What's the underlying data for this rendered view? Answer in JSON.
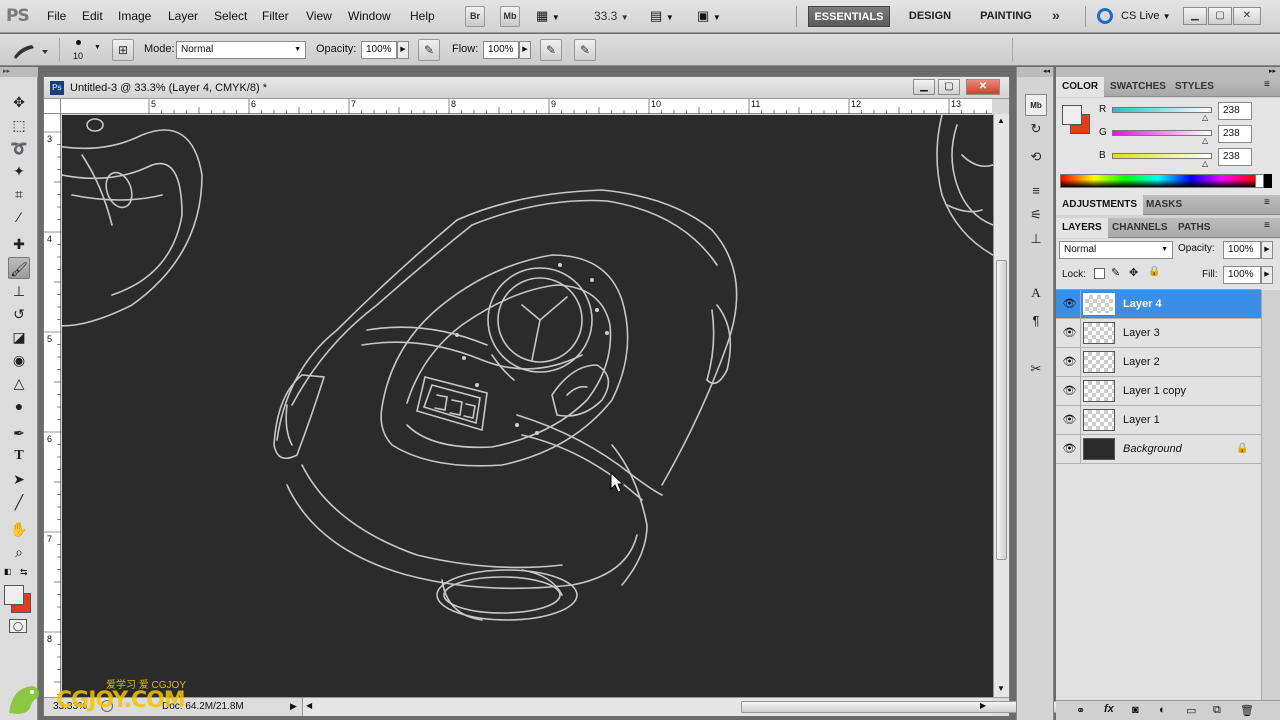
{
  "app": {
    "logo": "PS"
  },
  "menu": [
    "File",
    "Edit",
    "Image",
    "Layer",
    "Select",
    "Filter",
    "View",
    "Window",
    "Help"
  ],
  "menubar": {
    "br_label": "Br",
    "mb_label": "Mb",
    "zoom": "33.3",
    "workspaces": [
      "ESSENTIALS",
      "DESIGN",
      "PAINTING"
    ],
    "active_workspace": "ESSENTIALS",
    "cs_live": "CS Live"
  },
  "options": {
    "brush_size": "10",
    "mode_label": "Mode:",
    "mode_value": "Normal",
    "opacity_label": "Opacity:",
    "opacity_value": "100%",
    "flow_label": "Flow:",
    "flow_value": "100%"
  },
  "document": {
    "title": "Untitled-3 @ 33.3% (Layer 4, CMYK/8) *",
    "ps_badge": "Ps",
    "ruler_top": [
      "5",
      "6",
      "7",
      "8",
      "9",
      "10",
      "11",
      "12",
      "13"
    ],
    "ruler_left": [
      "3",
      "4",
      "5",
      "6",
      "7",
      "8"
    ],
    "status_zoom": "33.33%",
    "status_doc": "Doc: 64.2M/21.8M"
  },
  "color_panel": {
    "tabs": [
      "COLOR",
      "SWATCHES",
      "STYLES"
    ],
    "channels": [
      {
        "label": "R",
        "value": "238",
        "color": "#25c8d8"
      },
      {
        "label": "G",
        "value": "238",
        "color": "#d62ad6"
      },
      {
        "label": "B",
        "value": "238",
        "color": "#e2e21a"
      }
    ],
    "foreground": "#eeeeee",
    "background": "#e8391e"
  },
  "adjust_panel": {
    "tabs": [
      "ADJUSTMENTS",
      "MASKS"
    ]
  },
  "layers_panel": {
    "tabs": [
      "LAYERS",
      "CHANNELS",
      "PATHS"
    ],
    "blend_mode": "Normal",
    "opacity_label": "Opacity:",
    "opacity_value": "100%",
    "lock_label": "Lock:",
    "fill_label": "Fill:",
    "fill_value": "100%",
    "layers": [
      {
        "name": "Layer 4",
        "selected": true
      },
      {
        "name": "Layer 3",
        "selected": false
      },
      {
        "name": "Layer 2",
        "selected": false
      },
      {
        "name": "Layer 1 copy",
        "selected": false
      },
      {
        "name": "Layer 1",
        "selected": false
      },
      {
        "name": "Background",
        "selected": false
      }
    ]
  },
  "watermark": {
    "cn": "爱学习 爱 CGJOY",
    "en": "CGJOY.COM"
  }
}
